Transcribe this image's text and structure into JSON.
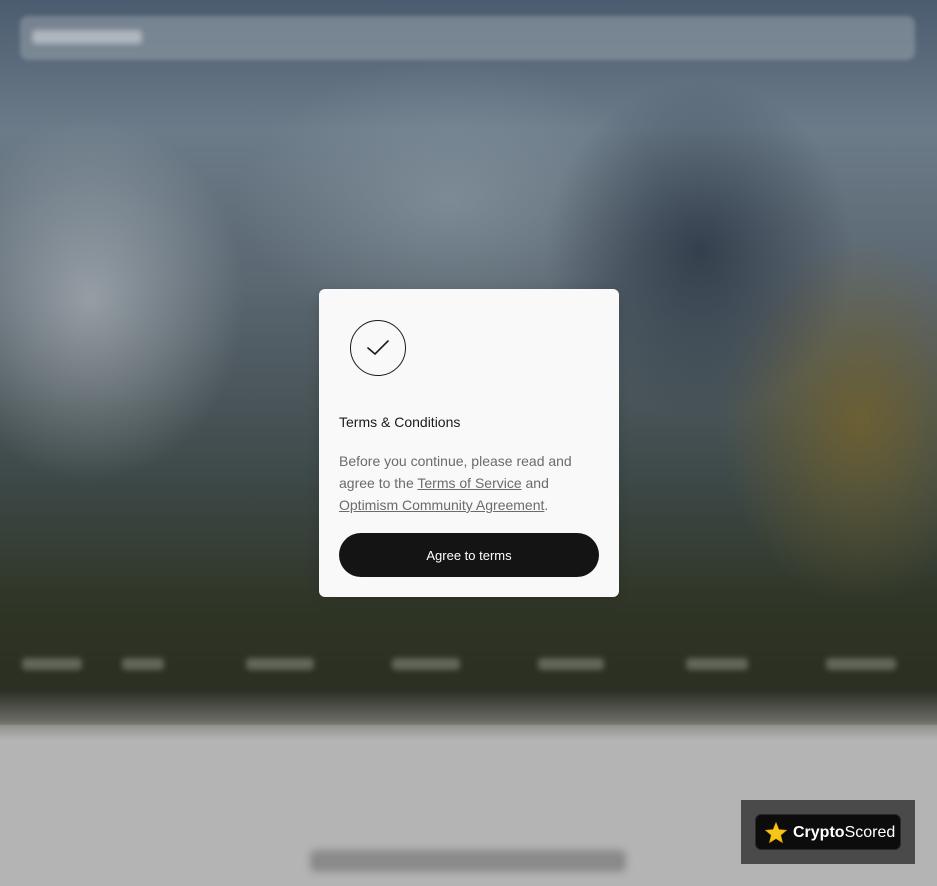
{
  "modal": {
    "title": "Terms & Conditions",
    "body_prefix": "Before you continue, please read and agree to the ",
    "terms_link": "Terms of Service",
    "body_middle": " and ",
    "agreement_link": "Optimism Community Agreement",
    "body_suffix": ".",
    "button_label": "Agree to terms"
  },
  "badge": {
    "brand_bold": "Crypto",
    "brand_regular": "Scored",
    "star_color": "#f5c518"
  },
  "icons": {
    "check": "check-icon",
    "star": "star-icon"
  },
  "colors": {
    "button_bg": "#141414",
    "modal_bg": "#f9f9f9",
    "overlay_bottom": "#b4b4b4"
  }
}
